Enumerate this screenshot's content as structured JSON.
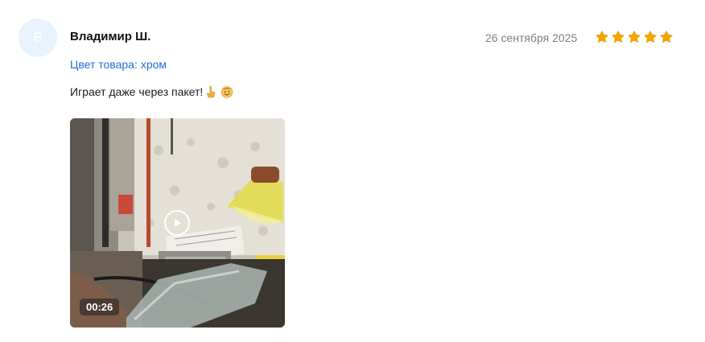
{
  "review": {
    "avatar_letter": "В",
    "author": "Владимир Ш.",
    "date": "26 сентября 2025",
    "rating": 5,
    "variant_label": "Цвет товара:",
    "variant_value": "хром",
    "text": "Играет даже через пакет!",
    "emojis": [
      "pointing-finger-emoji",
      "smiling-face-emoji"
    ],
    "video": {
      "duration": "00:26"
    }
  },
  "colors": {
    "star": "#f5a300",
    "link": "#1f6ed4",
    "avatar_bg": "#e8f3fd",
    "date": "#7b7f86"
  }
}
